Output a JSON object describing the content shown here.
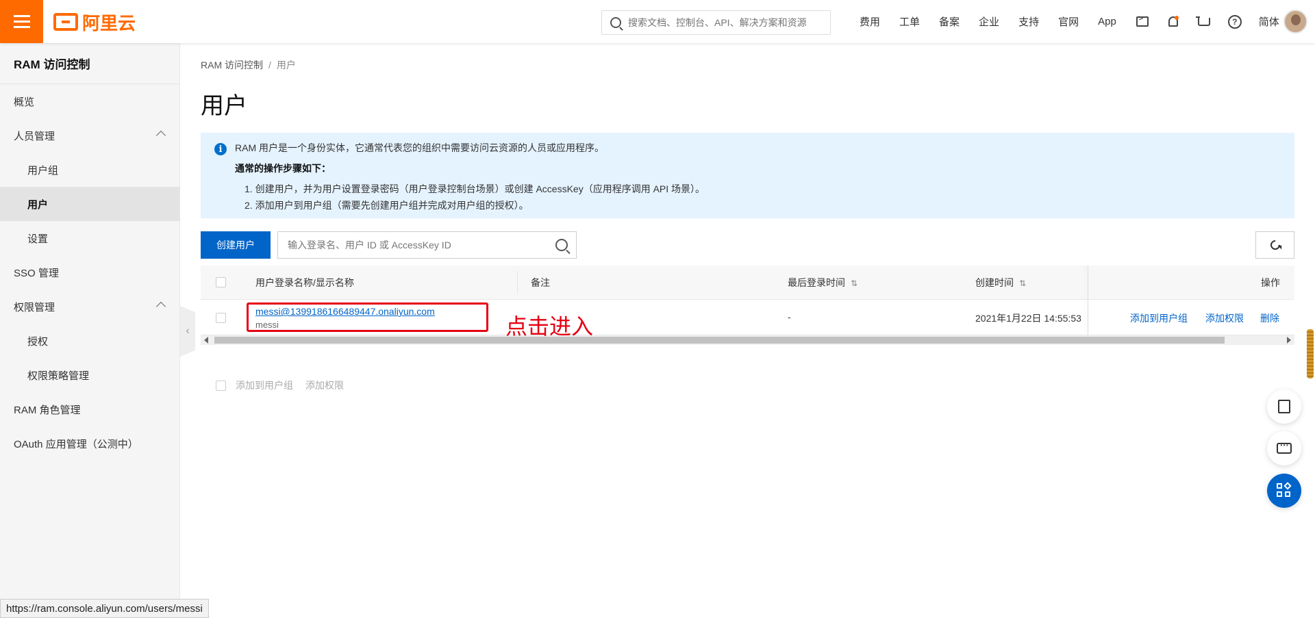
{
  "topbar": {
    "logo_text": "阿里云",
    "search_placeholder": "搜索文档、控制台、API、解决方案和资源",
    "nav": [
      "费用",
      "工单",
      "备案",
      "企业",
      "支持",
      "官网",
      "App"
    ],
    "lang": "简体",
    "accent": "#ff6a00"
  },
  "sidebar": {
    "title": "RAM 访问控制",
    "items": [
      {
        "label": "概览"
      },
      {
        "label": "人员管理"
      },
      {
        "label": "用户组"
      },
      {
        "label": "用户"
      },
      {
        "label": "设置"
      },
      {
        "label": "SSO 管理"
      },
      {
        "label": "权限管理"
      },
      {
        "label": "授权"
      },
      {
        "label": "权限策略管理"
      },
      {
        "label": "RAM 角色管理"
      },
      {
        "label": "OAuth 应用管理（公测中）"
      }
    ]
  },
  "breadcrumb": {
    "root": "RAM 访问控制",
    "sep": "/",
    "current": "用户"
  },
  "page": {
    "title": "用户"
  },
  "notice": {
    "line1": "RAM 用户是一个身份实体，它通常代表您的组织中需要访问云资源的人员或应用程序。",
    "line2": "通常的操作步骤如下：",
    "line3": "1. 创建用户，并为用户设置登录密码（用户登录控制台场景）或创建 AccessKey（应用程序调用 API 场景）。",
    "line4": "2. 添加用户到用户组（需要先创建用户组并完成对用户组的授权）。"
  },
  "toolbar": {
    "create_label": "创建用户",
    "search_placeholder": "输入登录名、用户 ID 或 AccessKey ID"
  },
  "table": {
    "columns": {
      "name": "用户登录名称/显示名称",
      "note": "备注",
      "last_login": "最后登录时间",
      "created": "创建时间",
      "ops": "操作"
    },
    "rows": [
      {
        "login": "messi@1399186166489447.onaliyun.com",
        "display": "messi",
        "note": "",
        "last_login": "-",
        "created": "2021年1月22日 14:55:53",
        "ops": [
          "添加到用户组",
          "添加权限",
          "删除"
        ]
      }
    ]
  },
  "bulk": {
    "add_group": "添加到用户组",
    "add_perm": "添加权限"
  },
  "annotation": {
    "text": "点击进入",
    "color": "#e60012"
  },
  "status_url": "https://ram.console.aliyun.com/users/messi"
}
